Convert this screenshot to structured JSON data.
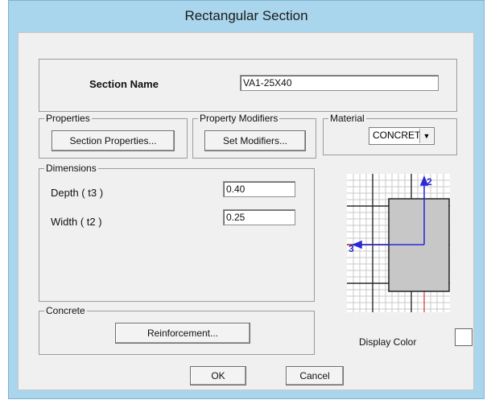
{
  "window": {
    "title": "Rectangular Section"
  },
  "section": {
    "label": "Section Name",
    "value": "VA1-25X40"
  },
  "properties": {
    "group_label": "Properties",
    "button_label": "Section Properties..."
  },
  "modifiers": {
    "group_label": "Property Modifiers",
    "button_label": "Set Modifiers..."
  },
  "material": {
    "group_label": "Material",
    "selected": "CONCRETC"
  },
  "dimensions": {
    "group_label": "Dimensions",
    "depth_label": "Depth  ( t3 )",
    "depth_value": "0.40",
    "width_label": "Width  ( t2 )",
    "width_value": "0.25"
  },
  "preview": {
    "axis2_label": "2",
    "axis3_label": "3"
  },
  "concrete": {
    "group_label": "Concrete",
    "button_label": "Reinforcement..."
  },
  "display_color": {
    "label": "Display Color",
    "color": "#ffffff"
  },
  "buttons": {
    "ok_label": "OK",
    "cancel_label": "Cancel"
  }
}
